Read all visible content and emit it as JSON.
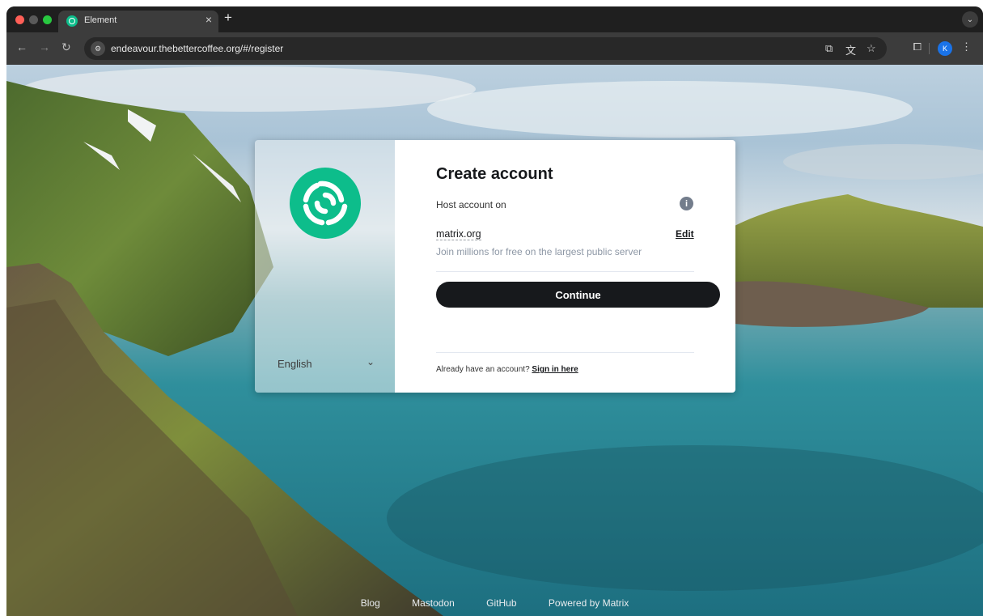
{
  "browser": {
    "tab_title": "Element",
    "tab_close": "×",
    "new_tab": "+",
    "tab_menu": "⌄",
    "url": "endeavour.thebettercoffee.org/#/register",
    "profile_initial": "K",
    "icons": [
      "back-icon",
      "forward-icon",
      "reload-icon",
      "site-info-icon",
      "cast-icon",
      "translate-icon",
      "star-icon",
      "extensions-icon",
      "menu-icon"
    ]
  },
  "auth": {
    "title": "Create account",
    "host_label": "Host account on",
    "server_name": "matrix.org",
    "edit_label": "Edit",
    "server_description": "Join millions for free on the largest public server",
    "continue_label": "Continue",
    "already_text": "Already have an account?",
    "signin_label": "Sign in here",
    "language": "English"
  },
  "footer": {
    "links": [
      "Blog",
      "Mastodon",
      "GitHub",
      "Powered by Matrix"
    ]
  },
  "colors": {
    "brand": "#0dbd8b",
    "button": "#17191c"
  }
}
